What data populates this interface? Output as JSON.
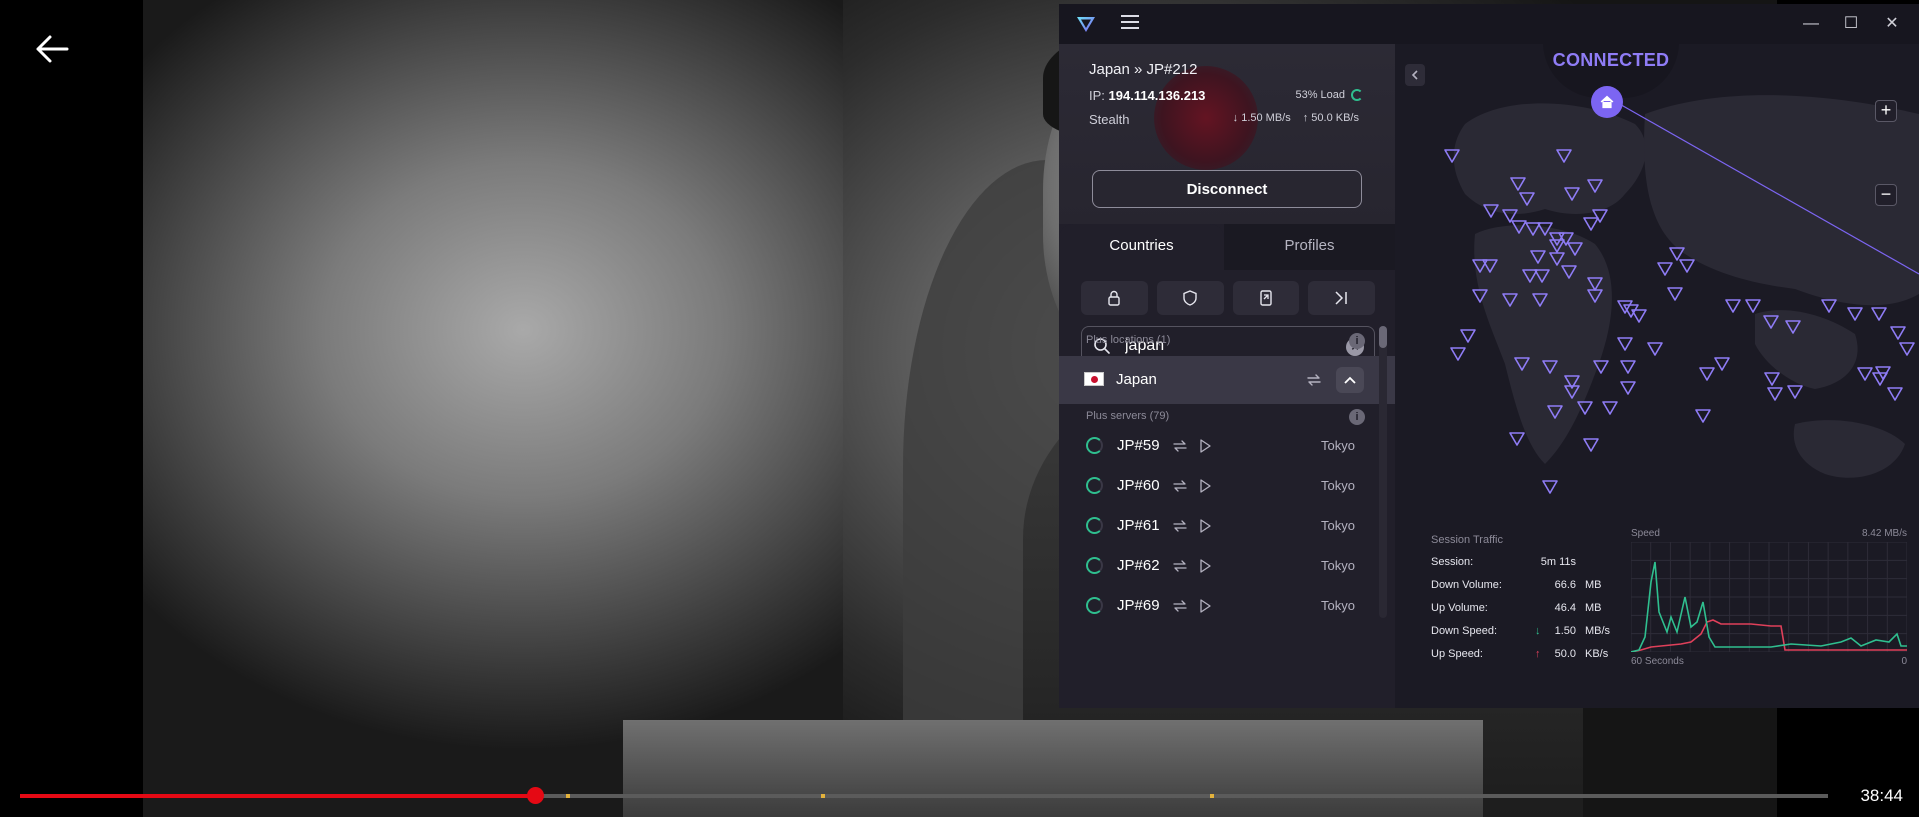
{
  "player": {
    "back_icon": "arrow-left-icon",
    "progress": 0.285,
    "markers": [
      0.302,
      0.443,
      0.658
    ],
    "time_left": "38:44"
  },
  "vpn": {
    "window_controls": [
      "minimize-icon",
      "maximize-icon",
      "close-icon"
    ],
    "connection": {
      "title": "Japan » JP#212",
      "ip_label": "IP:",
      "ip": "194.114.136.213",
      "load": "53% Load",
      "protocol": "Stealth",
      "down_speed": "1.50 MB/s",
      "up_speed": "50.0 KB/s",
      "disconnect_label": "Disconnect"
    },
    "tabs": [
      "Countries",
      "Profiles"
    ],
    "filter_icons": [
      "lock-icon",
      "shield-icon",
      "secure-core-icon",
      "split-tunnel-icon"
    ],
    "search": {
      "value": "japan"
    },
    "plus_locations_label": "Plus locations (1)",
    "country": {
      "name": "Japan"
    },
    "plus_servers_label": "Plus servers (79)",
    "servers": [
      {
        "name": "JP#59",
        "city": "Tokyo"
      },
      {
        "name": "JP#60",
        "city": "Tokyo"
      },
      {
        "name": "JP#61",
        "city": "Tokyo"
      },
      {
        "name": "JP#62",
        "city": "Tokyo"
      },
      {
        "name": "JP#69",
        "city": "Tokyo"
      }
    ],
    "map": {
      "status": "CONNECTED",
      "zoom_in": "+",
      "zoom_out": "−"
    },
    "session_traffic": {
      "title": "Session Traffic",
      "rows": [
        {
          "label": "Session:",
          "arrow": "",
          "value": "5m 11s",
          "unit": ""
        },
        {
          "label": "Down Volume:",
          "arrow": "",
          "value": "66.6",
          "unit": "MB"
        },
        {
          "label": "Up Volume:",
          "arrow": "",
          "value": "46.4",
          "unit": "MB"
        },
        {
          "label": "Down Speed:",
          "arrow": "↓",
          "value": "1.50",
          "unit": "MB/s"
        },
        {
          "label": "Up Speed:",
          "arrow": "↑",
          "value": "50.0",
          "unit": "KB/s"
        }
      ]
    },
    "speed_chart": {
      "title": "Speed",
      "max_label": "8.42  MB/s",
      "foot_left": "60 Seconds",
      "foot_right": "0",
      "colors": {
        "down": "#2fbf8f",
        "up": "#e0405a"
      }
    }
  }
}
